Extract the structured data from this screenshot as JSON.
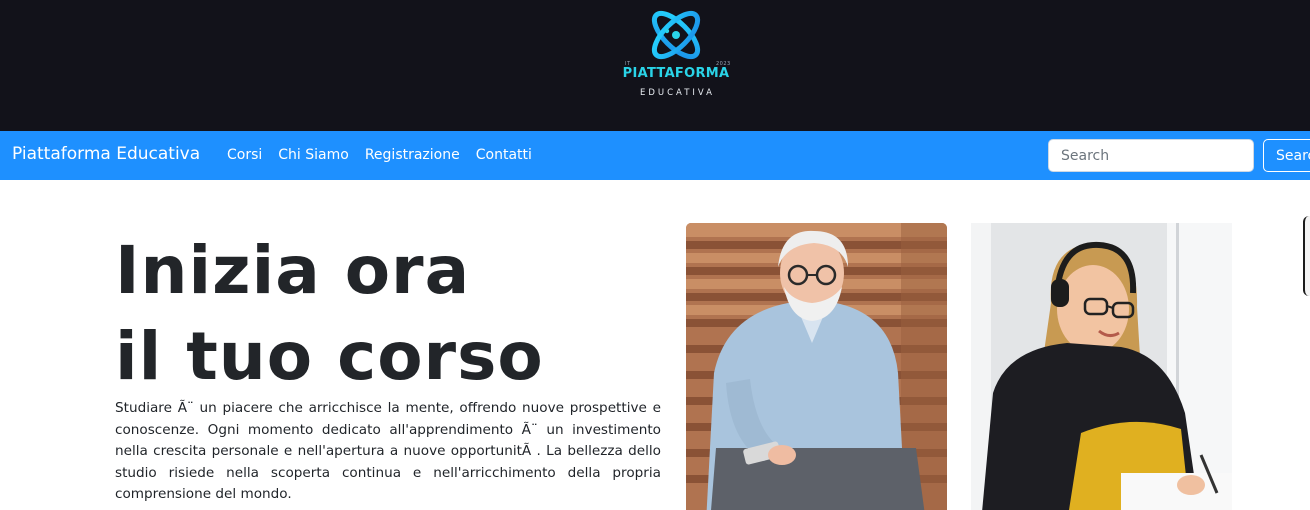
{
  "logo": {
    "corner_left": "IT",
    "corner_right": "2023",
    "title": "PIATTAFORMA",
    "subtitle": "EDUCATIVA",
    "icon": "atom-logo-icon",
    "accent_color": "#2ad4e8"
  },
  "navbar": {
    "brand": "Piattaforma Educativa",
    "links": [
      "Corsi",
      "Chi Siamo",
      "Registrazione",
      "Contatti"
    ],
    "search_placeholder": "Search",
    "search_button": "Search",
    "background_color": "#1e90ff"
  },
  "hero": {
    "title_line1": "Inizia ora",
    "title_line2": "il tuo corso",
    "text": "Studiare Ã¨ un piacere che arricchisce la mente, offrendo nuove prospettive e conoscenze. Ogni momento dedicato all'apprendimento Ã¨ un investimento nella crescita personale e nell'apertura a nuove opportunitÃ . La bellezza dello studio risiede nella scoperta continua e nell'arricchimento della propria comprensione del mondo."
  },
  "photos": {
    "first": "photo-older-man-smiling",
    "second": "photo-woman-with-headphones-writing"
  }
}
